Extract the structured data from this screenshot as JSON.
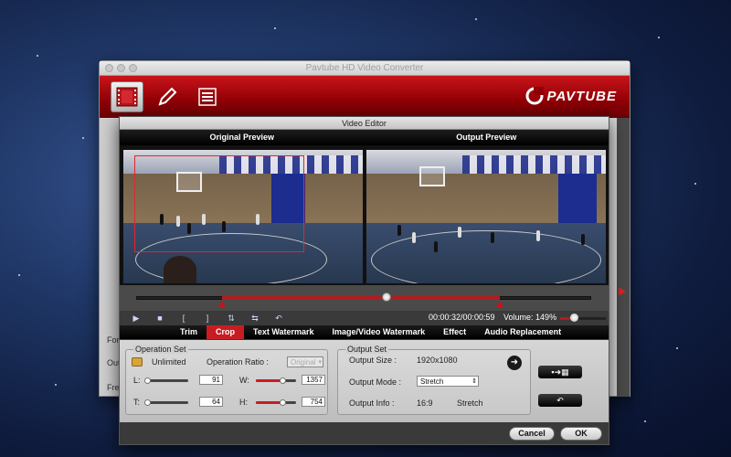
{
  "main_window": {
    "title": "Pavtube HD Video Converter",
    "brand": "PAVTUBE",
    "toolbar_icons": [
      "film-icon",
      "pencil-icon",
      "list-icon"
    ],
    "left_labels": [
      "For",
      "Out",
      "Free"
    ]
  },
  "editor": {
    "title": "Video Editor",
    "original_preview": "Original Preview",
    "output_preview": "Output Preview",
    "time": "00:00:32/00:00:59",
    "volume_label": "Volume:",
    "volume_value": "149%",
    "volume_level": 0.3,
    "timeline_position": 0.55,
    "tabs": [
      "Trim",
      "Crop",
      "Text Watermark",
      "Image/Video Watermark",
      "Effect",
      "Audio Replacement"
    ],
    "active_tab": "Crop",
    "operation_set": {
      "title": "Operation Set",
      "mode": "Unlimited",
      "ratio_label": "Operation Ratio :",
      "ratio_value": "Original",
      "L_label": "L:",
      "L_value": "91",
      "W_label": "W:",
      "W_value": "1357",
      "T_label": "T:",
      "T_value": "64",
      "H_label": "H:",
      "H_value": "754"
    },
    "output_set": {
      "title": "Output Set",
      "size_label": "Output Size :",
      "size_value": "1920x1080",
      "mode_label": "Output Mode :",
      "mode_value": "Stretch",
      "info_label": "Output Info :",
      "info_ratio": "16:9",
      "info_mode": "Stretch"
    },
    "cancel": "Cancel",
    "ok": "OK"
  },
  "colors": {
    "accent": "#c71d22",
    "toolbar": "#8f0006"
  }
}
